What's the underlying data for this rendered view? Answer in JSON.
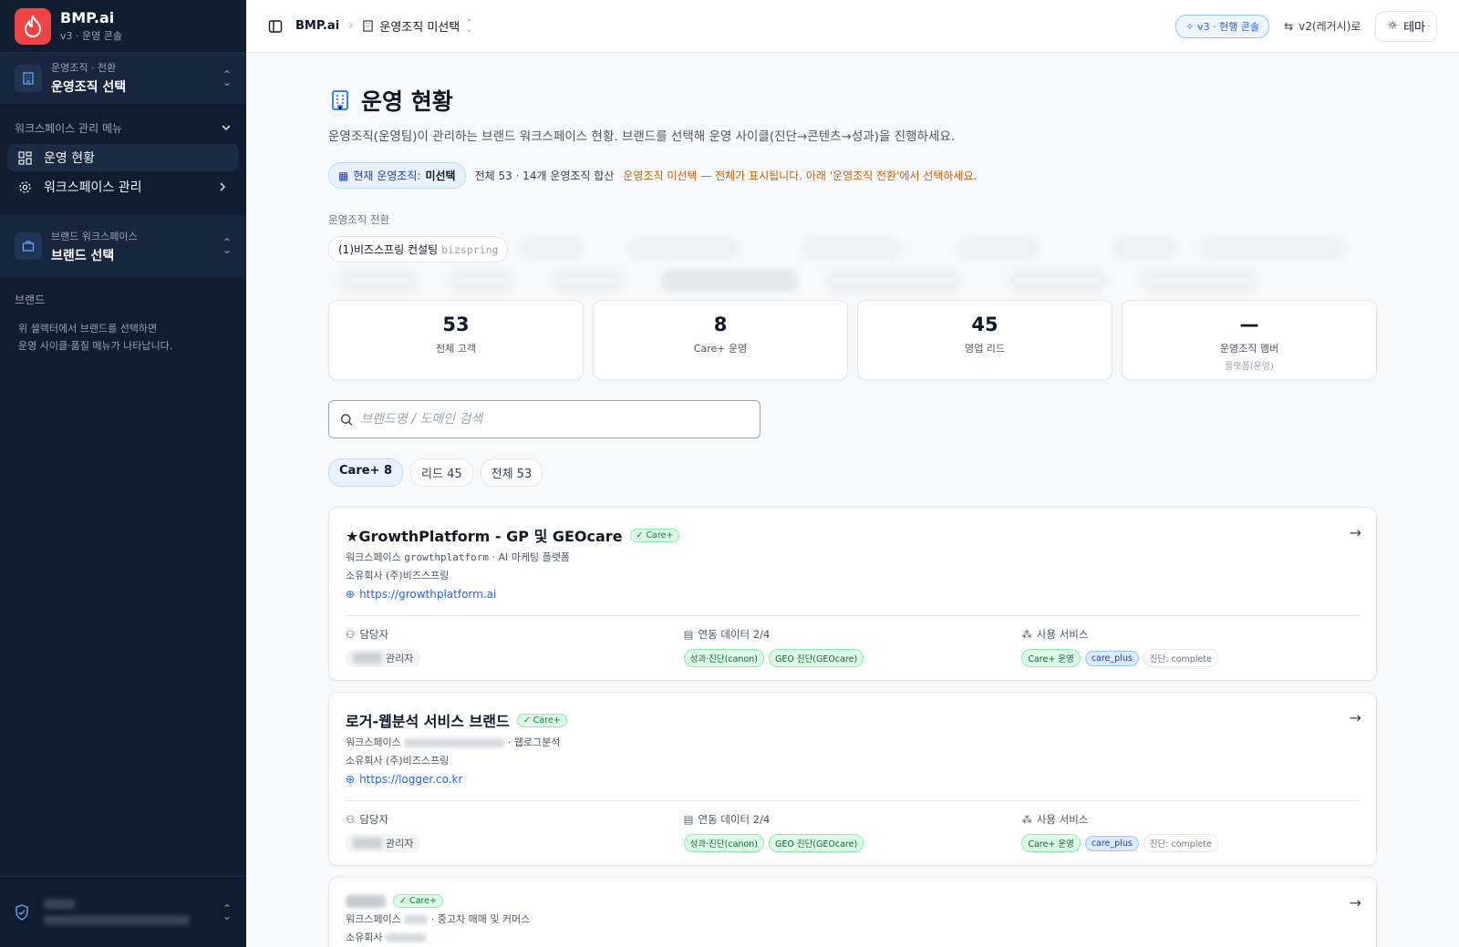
{
  "sidebar": {
    "app_name": "BMP.ai",
    "app_sub": "v3 · 운영 콘솔",
    "org_switch_label": "운영조직 · 전환",
    "org_switch_value": "운영조직 선택",
    "menu_title": "워크스페이스 관리 메뉴",
    "menu_items": [
      {
        "label": "운영 현황",
        "icon": "dashboard-icon"
      },
      {
        "label": "워크스페이스 관리",
        "icon": "gear-icon"
      }
    ],
    "brand_ws_label": "브랜드 워크스페이스",
    "brand_ws_value": "브랜드 선택",
    "brand_section_label": "브랜드",
    "brand_hint_1": "위 셀렉터에서 브랜드를 선택하면",
    "brand_hint_2": "운영 사이클·품질 메뉴가 나타납니다."
  },
  "topbar": {
    "app_name": "BMP.ai",
    "org_crumb": "운영조직 미선택",
    "v3_pill": "v3 · 현행 콘솔",
    "legacy_link": "v2(레거시)로",
    "theme_button": "테마"
  },
  "main": {
    "title": "운영 현황",
    "description": "운영조직(운영팀)이 관리하는 브랜드 워크스페이스 현황. 브랜드를 선택해 운영 사이클(진단→콘텐츠→성과)을 진행하세요.",
    "current_org_label": "현재 운영조직:",
    "current_org_value": "미선택",
    "current_total": "전체 53 · 14개 운영조직 합산",
    "current_warning": "운영조직 미선택 — 전체가 표시됩니다. 아래 '운영조직 전환'에서 선택하세요.",
    "switch_label": "운영조직 전환",
    "first_org_chip": "(1)비즈스프링 컨설팅",
    "first_org_code": "bizspring"
  },
  "stats": [
    {
      "value": "53",
      "label": "전체 고객",
      "sub": ""
    },
    {
      "value": "8",
      "label": "Care+ 운영",
      "sub": ""
    },
    {
      "value": "45",
      "label": "영업 리드",
      "sub": ""
    },
    {
      "value": "—",
      "label": "운영조직 멤버",
      "sub": "플랫폼(운영)"
    }
  ],
  "search": {
    "placeholder": "브랜드명 / 도메인 검색"
  },
  "filters": [
    "Care+ 8",
    "리드 45",
    "전체 53"
  ],
  "cards": [
    {
      "title": "★GrowthPlatform - GP 및 GEOcare",
      "badge": "Care+",
      "ws_label": "워크스페이스",
      "ws_code": "growthplatform",
      "ws_desc": "· AI 마케팅 플랫폼",
      "owner": "소유회사 (주)비즈스프링",
      "url": "https://growthplatform.ai",
      "manager_label": "담당자",
      "manager_role": "관리자",
      "data_label": "연동 데이터 2/4",
      "data_tags": [
        "성과·진단(canon)",
        "GEO 진단(GEOcare)"
      ],
      "service_label": "사용 서비스",
      "service_tags": [
        "Care+ 운영",
        "care_plus",
        "진단: complete"
      ]
    },
    {
      "title": "로거-웹분석 서비스 브랜드",
      "badge": "Care+",
      "ws_label": "워크스페이스",
      "ws_code": "",
      "ws_desc": "· 웹로그분석",
      "owner": "소유회사 (주)비즈스프링",
      "url": "https://logger.co.kr",
      "manager_label": "담당자",
      "manager_role": "관리자",
      "data_label": "연동 데이터 2/4",
      "data_tags": [
        "성과·진단(canon)",
        "GEO 진단(GEOcare)"
      ],
      "service_label": "사용 서비스",
      "service_tags": [
        "Care+ 운영",
        "care_plus",
        "진단: complete"
      ]
    },
    {
      "title": "",
      "badge": "Care+",
      "ws_label": "워크스페이스",
      "ws_desc": "· 중고차 매매 및 커머스",
      "owner": "소유회사"
    }
  ]
}
